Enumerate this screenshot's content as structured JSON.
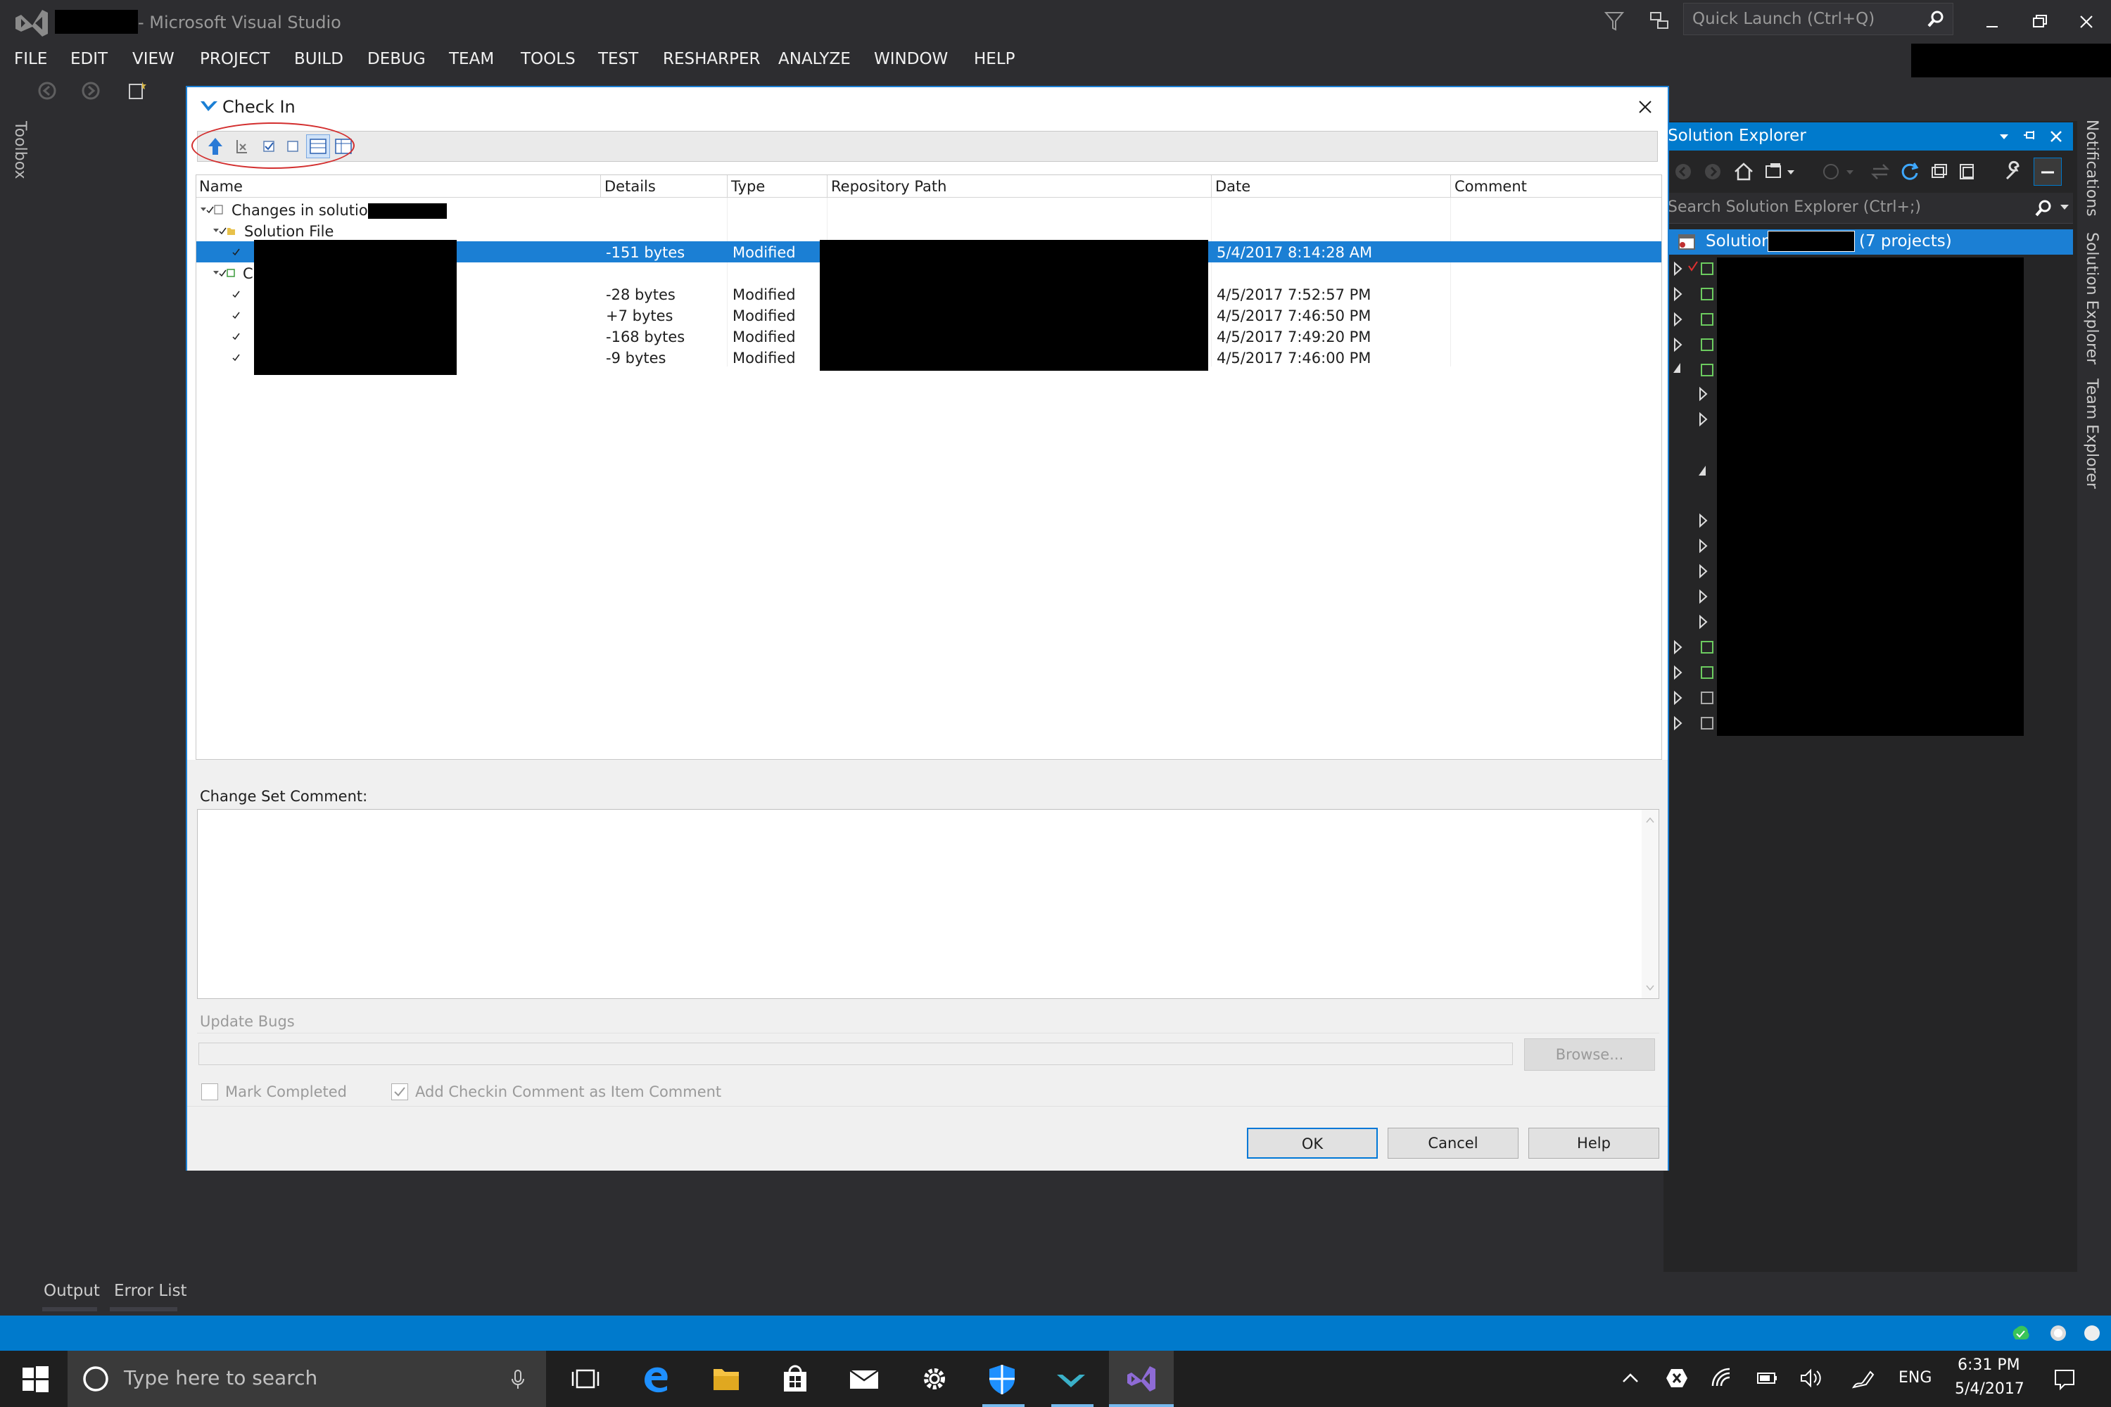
{
  "window": {
    "app_title": "- Microsoft Visual Studio",
    "quick_launch_placeholder": "Quick Launch (Ctrl+Q)"
  },
  "menu": [
    "FILE",
    "EDIT",
    "VIEW",
    "PROJECT",
    "BUILD",
    "DEBUG",
    "TEAM",
    "TOOLS",
    "TEST",
    "RESHARPER",
    "ANALYZE",
    "WINDOW",
    "HELP"
  ],
  "left_rail": {
    "toolbox": "Toolbox"
  },
  "dialog": {
    "title": "Check In",
    "columns": [
      "Name",
      "Details",
      "Type",
      "Repository Path",
      "Date",
      "Comment"
    ],
    "tree": {
      "root_label": "Changes in solution",
      "solution_file_label": "Solution File",
      "group_prefix": "C"
    },
    "rows": [
      {
        "details": "-151 bytes",
        "type": "Modified",
        "date": "5/4/2017 8:14:28 AM",
        "selected": true
      },
      {
        "details": "-28 bytes",
        "type": "Modified",
        "date": "4/5/2017 7:52:57 PM"
      },
      {
        "details": "+7 bytes",
        "type": "Modified",
        "date": "4/5/2017 7:46:50 PM"
      },
      {
        "details": "-168 bytes",
        "type": "Modified",
        "date": "4/5/2017 7:49:20 PM"
      },
      {
        "details": "-9 bytes",
        "type": "Modified",
        "date": "4/5/2017 7:46:00 PM"
      }
    ],
    "change_set_comment_label": "Change Set Comment:",
    "change_set_comment_value": "",
    "update_bugs_label": "Update Bugs",
    "browse_label": "Browse...",
    "mark_completed_label": "Mark Completed",
    "add_checkin_comment_label": "Add Checkin Comment as Item Comment",
    "ok_label": "OK",
    "cancel_label": "Cancel",
    "help_label": "Help"
  },
  "solution_explorer": {
    "title": "Solution Explorer",
    "search_placeholder": "Search Solution Explorer (Ctrl+;)",
    "solution_label": "Solution",
    "projects_label": "(7 projects)"
  },
  "right_tabs": [
    "Notifications",
    "Solution Explorer",
    "Team Explorer"
  ],
  "bottom_tabs": [
    "Output",
    "Error List"
  ],
  "taskbar": {
    "search_placeholder": "Type here to search",
    "language": "ENG",
    "time": "6:31 PM",
    "date": "5/4/2017"
  },
  "colors": {
    "accent": "#007acc",
    "selection": "#1b7fd4",
    "ide_bg": "#2d2d30",
    "annotation_red": "#d32f2f"
  }
}
